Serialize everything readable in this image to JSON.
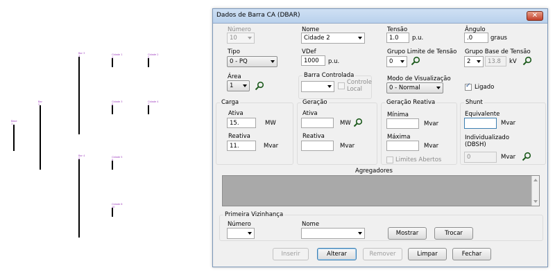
{
  "diagram": {
    "buses": [
      {
        "label": "Base\n1"
      },
      {
        "label": "Bar\n2"
      },
      {
        "label": "Bar 3\n3"
      },
      {
        "label": "Cidade 1\n4"
      },
      {
        "label": "Cidade 2\n5"
      },
      {
        "label": "Cidade 3\n6"
      },
      {
        "label": "Cidade 4\n7"
      },
      {
        "label": "Bar 4\n8"
      },
      {
        "label": "Cidade 5\n9"
      },
      {
        "label": "Cidade 6\n10"
      }
    ]
  },
  "dialog": {
    "title": "Dados de Barra CA (DBAR)",
    "close": "✕",
    "numero": {
      "label": "Número",
      "value": "10"
    },
    "nome": {
      "label": "Nome",
      "value": "Cidade 2"
    },
    "tensao": {
      "label": "Tensão",
      "value": "1.0",
      "unit": "p.u."
    },
    "angulo": {
      "label": "Ângulo",
      "value": ".0",
      "unit": "graus"
    },
    "tipo": {
      "label": "Tipo",
      "value": "0 - PQ"
    },
    "vdef": {
      "label": "VDef",
      "value": "1000",
      "unit": "p.u."
    },
    "grupo_limite": {
      "label": "Grupo Limite de Tensão",
      "value": "0"
    },
    "grupo_base": {
      "label": "Grupo Base de Tensão",
      "value": "2",
      "kv_value": "13.8",
      "kv_unit": "kV"
    },
    "area": {
      "label": "Área",
      "value": "1"
    },
    "barra_controlada": {
      "label": "Barra Controlada",
      "value": "",
      "controle_local": "Controle\nLocal"
    },
    "modo_visualizacao": {
      "label": "Modo de Visualização",
      "value": "0 - Normal"
    },
    "ligado": {
      "label": "Ligado",
      "checked": true
    },
    "carga": {
      "title": "Carga",
      "ativa_label": "Ativa",
      "ativa_value": "15.",
      "ativa_unit": "MW",
      "reativa_label": "Reativa",
      "reativa_value": "11.",
      "reativa_unit": "Mvar"
    },
    "geracao": {
      "title": "Geração",
      "ativa_label": "Ativa",
      "ativa_value": "",
      "ativa_unit": "MW",
      "reativa_label": "Reativa",
      "reativa_value": "",
      "reativa_unit": "Mvar"
    },
    "geracao_reativa": {
      "title": "Geração Reativa",
      "minima_label": "Mínima",
      "minima_value": "",
      "minima_unit": "Mvar",
      "maxima_label": "Máxima",
      "maxima_value": "",
      "maxima_unit": "Mvar",
      "limites_abertos": "Limites Abertos"
    },
    "shunt": {
      "title": "Shunt",
      "equivalente_label": "Equivalente",
      "equivalente_value": "",
      "equivalente_unit": "Mvar",
      "individualizado_label": "Individualizado\n(DBSH)",
      "individualizado_value": "0",
      "individualizado_unit": "Mvar"
    },
    "agregadores": {
      "title": "Agregadores"
    },
    "vizinhanca": {
      "title": "Primeira Vizinhança",
      "numero_label": "Número",
      "numero_value": "",
      "nome_label": "Nome",
      "nome_value": "",
      "mostrar": "Mostrar",
      "trocar": "Trocar"
    },
    "buttons": {
      "inserir": "Inserir",
      "alterar": "Alterar",
      "remover": "Remover",
      "limpar": "Limpar",
      "fechar": "Fechar"
    },
    "colors": {
      "titlebar": "#b9d1ec",
      "close": "#c2402a",
      "agregadores_bg": "#a9a9a9",
      "bus_label": "#a040c0"
    }
  }
}
